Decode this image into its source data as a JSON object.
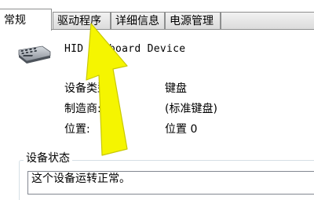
{
  "tabs": [
    {
      "label": "常规",
      "active": true
    },
    {
      "label": "驱动程序",
      "active": false
    },
    {
      "label": "详细信息",
      "active": false
    },
    {
      "label": "电源管理",
      "active": false
    }
  ],
  "device": {
    "icon": "keyboard-icon",
    "name": "HID Keyboard Device"
  },
  "properties": {
    "device_type_label": "设备类型:",
    "device_type_value": "键盘",
    "manufacturer_label": "制造商:",
    "manufacturer_value": "(标准键盘)",
    "location_label": "位置:",
    "location_value": "位置 0"
  },
  "status": {
    "group_title": "设备状态",
    "text": "这个设备运转正常。"
  },
  "annotation": {
    "color": "#f5f500",
    "shape": "arrow-pointing-up"
  }
}
